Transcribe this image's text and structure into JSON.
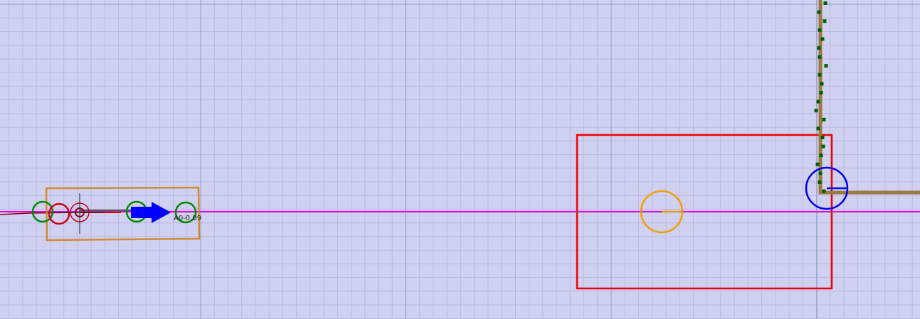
{
  "canvas": {
    "background": "#d0d0f0",
    "grid_minor_color": "#b8b8e0",
    "grid_major_color": "#9898c8"
  },
  "vehicle": {
    "label": "A0-0.09",
    "box_color": "#d08a30",
    "arrow_color": "#0000ff",
    "marker_colors": {
      "green": "#008a00",
      "red": "#d0001a",
      "dark_red": "#900020"
    }
  },
  "path": {
    "lane_color": "#dd00dd",
    "trail_color": "#8a0010"
  },
  "target_zone": {
    "border_color": "#ee0000",
    "center_marker_color": "#f0a000"
  },
  "track": {
    "color": "#9a7a40",
    "dot_color": "#006000",
    "goal_marker_color": "#0000ee"
  },
  "icons": {
    "vehicle": "arrow-right-icon",
    "waypoint": "circle-icon",
    "crosshair": "crosshair-icon"
  }
}
